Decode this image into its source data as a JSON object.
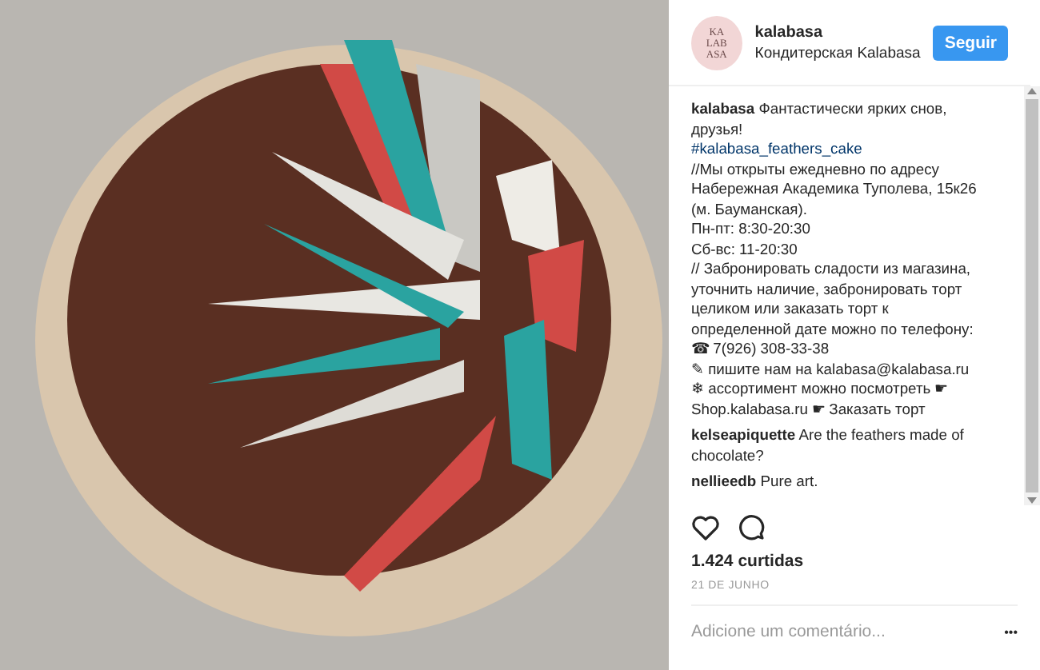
{
  "header": {
    "avatar_lines": [
      "KA",
      "LAB",
      "ASA"
    ],
    "username": "kalabasa",
    "location": "Кондитерская Kalabasa",
    "follow_button": "Seguir"
  },
  "caption": {
    "lines": [
      {
        "kind": "text",
        "text": "**kalabasa** Фантастически ярких снов,"
      },
      {
        "kind": "text",
        "text": "друзья!"
      },
      {
        "kind": "link",
        "text": "#kalabasa_feathers_cake"
      },
      {
        "kind": "text",
        "text": "//Мы открыты ежедневно по адресу"
      },
      {
        "kind": "text",
        "text": "Набережная Академика Туполева, 15к26"
      },
      {
        "kind": "text",
        "text": "(м. Бауманская)."
      },
      {
        "kind": "text",
        "text": "Пн-пт: 8:30-20:30"
      },
      {
        "kind": "text",
        "text": "Сб-вс: 11-20:30"
      },
      {
        "kind": "text",
        "text": "// Забронировать сладости из магазина,"
      },
      {
        "kind": "text",
        "text": "уточнить наличие, забронировать торт"
      },
      {
        "kind": "text",
        "text": "целиком или заказать торт к"
      },
      {
        "kind": "text",
        "text": "определенной дате можно по телефону:"
      },
      {
        "kind": "text",
        "text": "☎ 7(926) 308-33-38"
      },
      {
        "kind": "text",
        "text": "✎ пишите нам на kalabasa@kalabasa.ru"
      },
      {
        "kind": "text",
        "text": "❄ ассортимент можно посмотреть ☛"
      },
      {
        "kind": "text",
        "text": "Shop.kalabasa.ru ☛ Заказать торт"
      }
    ]
  },
  "comments": [
    {
      "lines": [
        "**kelseapiquette** Are the feathers made of",
        "chocolate?"
      ]
    },
    {
      "lines": [
        "**nellieedb** Pure art."
      ]
    }
  ],
  "likes": "1.424 curtidas",
  "date": "21 DE JUNHO",
  "comment_field": {
    "placeholder": "Adicione um comentário..."
  },
  "more_button": "•••"
}
